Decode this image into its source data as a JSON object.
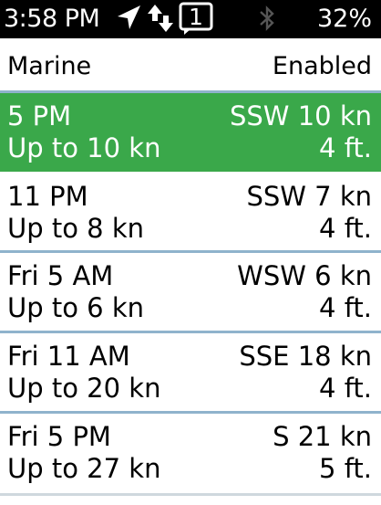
{
  "statusbar": {
    "time": "3:58 PM",
    "notification_count": "1",
    "battery": "32%"
  },
  "header": {
    "title": "Marine",
    "status": "Enabled"
  },
  "forecast": [
    {
      "time": "5 PM",
      "wind_speed": "Up to 10 kn",
      "direction": "SSW 10 kn",
      "waves": "4 ft.",
      "selected": true
    },
    {
      "time": "11 PM",
      "wind_speed": "Up to 8 kn",
      "direction": "SSW 7 kn",
      "waves": "4 ft."
    },
    {
      "time": "Fri 5 AM",
      "wind_speed": "Up to 6 kn",
      "direction": "WSW 6 kn",
      "waves": "4 ft."
    },
    {
      "time": "Fri 11 AM",
      "wind_speed": "Up to 20 kn",
      "direction": "SSE 18 kn",
      "waves": "4 ft."
    },
    {
      "time": "Fri 5 PM",
      "wind_speed": "Up to 27 kn",
      "direction": "S 21 kn",
      "waves": "5 ft."
    }
  ],
  "colors": {
    "selected_bg": "#3aa84a",
    "divider": "#8fb3cc"
  }
}
